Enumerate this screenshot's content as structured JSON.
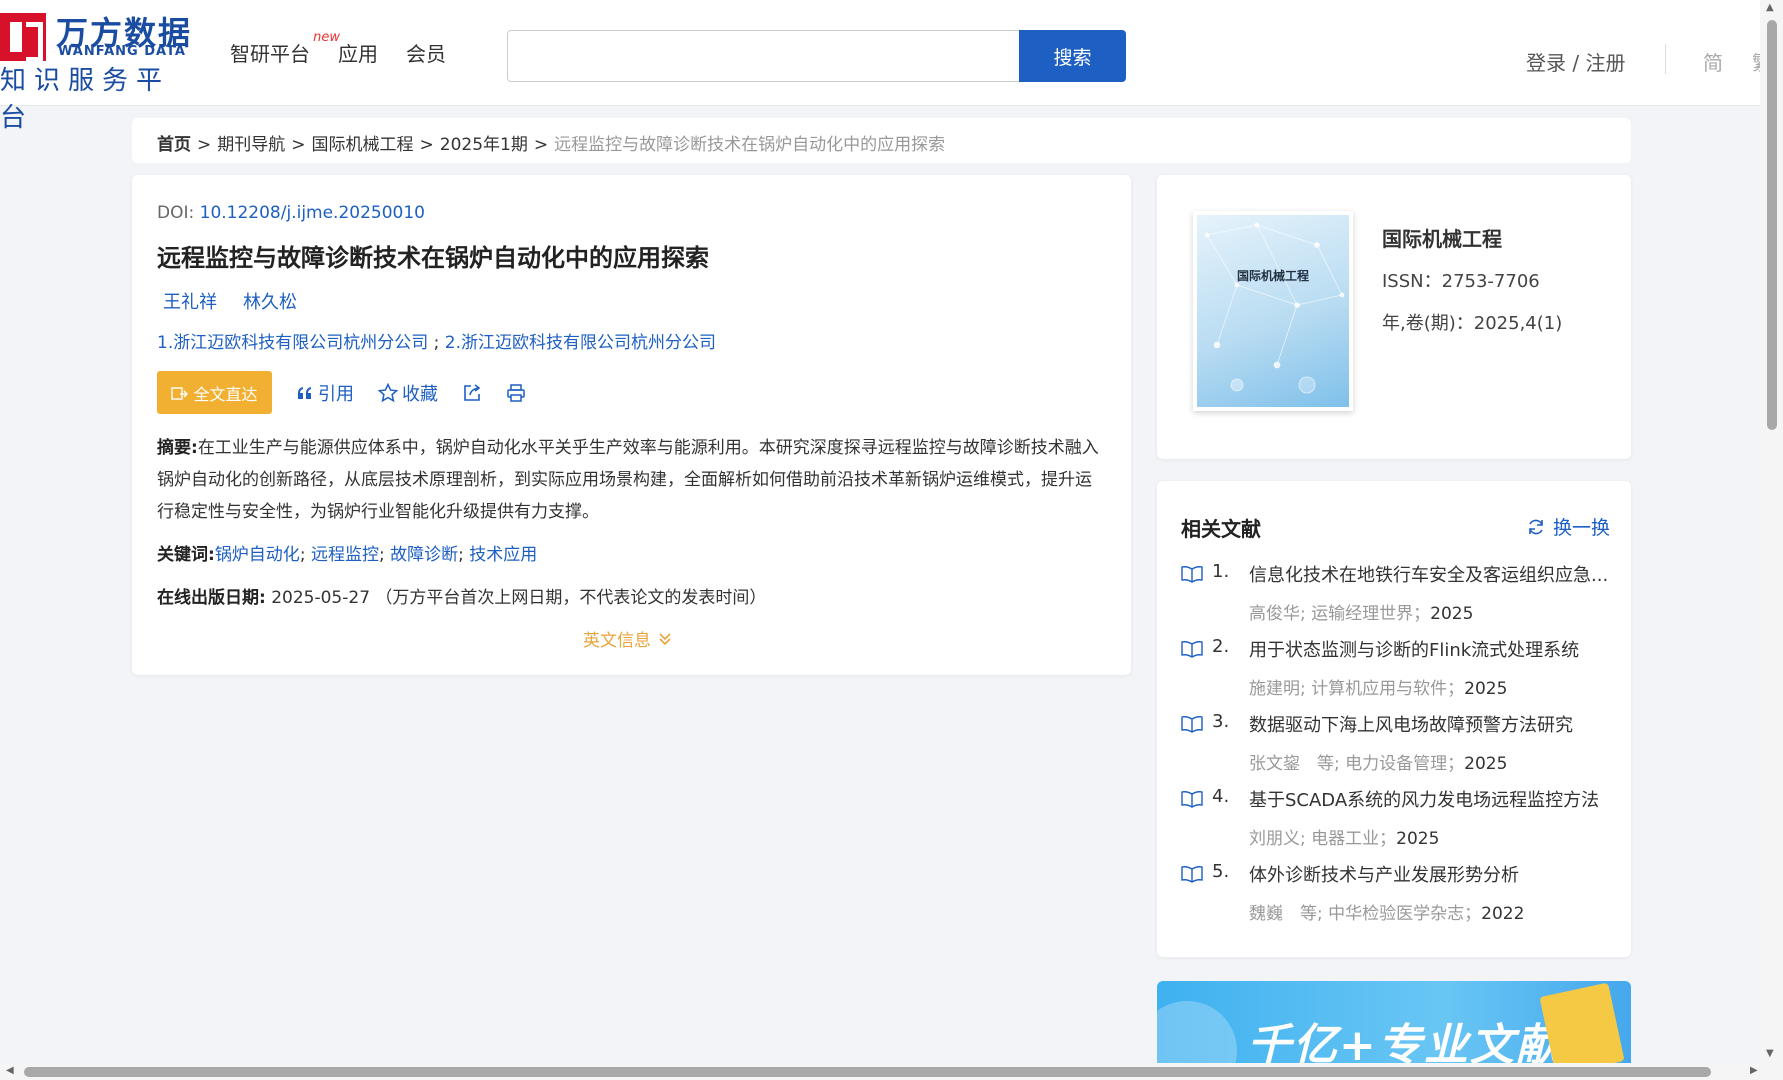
{
  "header": {
    "logo_cn": "万方数据",
    "logo_en": "WANFANG DATA",
    "logo_sub": "知识服务平台",
    "nav": [
      {
        "label": "智研平台",
        "badge": "new"
      },
      {
        "label": "应用"
      },
      {
        "label": "会员"
      }
    ],
    "search": {
      "value": "",
      "button": "搜索"
    },
    "login": "登录 / 注册",
    "lang_simplified": "简",
    "lang_traditional": "繁"
  },
  "breadcrumb": {
    "items": [
      "首页",
      "期刊导航",
      "国际机械工程",
      "2025年1期"
    ],
    "current": "远程监控与故障诊断技术在锅炉自动化中的应用探索"
  },
  "article": {
    "doi_label": "DOI: ",
    "doi": "10.12208/j.ijme.20250010",
    "title": "远程监控与故障诊断技术在锅炉自动化中的应用探索",
    "authors": [
      "王礼祥",
      "林久松"
    ],
    "affiliation_1": "1.浙江迈欧科技有限公司杭州分公司",
    "affiliation_sep": ";",
    "affiliation_2": "2.浙江迈欧科技有限公司杭州分公司",
    "fulltext_button": "全文直达",
    "cite": "引用",
    "favorite": "收藏",
    "abstract_label": "摘要:",
    "abstract": "在工业生产与能源供应体系中，锅炉自动化水平关乎生产效率与能源利用。本研究深度探寻远程监控与故障诊断技术融入锅炉自动化的创新路径，从底层技术原理剖析，到实际应用场景构建，全面解析如何借助前沿技术革新锅炉运维模式，提升运行稳定性与安全性，为锅炉行业智能化升级提供有力支撑。",
    "keywords_label": "关键词:",
    "keywords": [
      "锅炉自动化",
      "远程监控",
      "故障诊断",
      "技术应用"
    ],
    "pubdate_label": "在线出版日期:",
    "pubdate": "2025-05-27",
    "pubdate_note": "（万方平台首次上网日期，不代表论文的发表时间）",
    "english_info": "英文信息"
  },
  "journal": {
    "cover_title": "国际机械工程",
    "name": "国际机械工程",
    "issn": "ISSN：2753-7706",
    "volume": "年,卷(期)：2025,4(1)"
  },
  "related": {
    "title": "相关文献",
    "refresh": "换一换",
    "items": [
      {
        "num": "1.",
        "title": "信息化技术在地铁行车安全及客运组织应急...",
        "meta": "高俊华; 运输经理世界；",
        "year": "2025"
      },
      {
        "num": "2.",
        "title": "用于状态监测与诊断的Flink流式处理系统",
        "meta": "施建明; 计算机应用与软件；",
        "year": "2025"
      },
      {
        "num": "3.",
        "title": "数据驱动下海上风电场故障预警方法研究",
        "meta": "张文鋆　等; 电力设备管理；",
        "year": "2025"
      },
      {
        "num": "4.",
        "title": "基于SCADA系统的风力发电场远程监控方法",
        "meta": "刘朋义; 电器工业；",
        "year": "2025"
      },
      {
        "num": "5.",
        "title": "体外诊断技术与产业发展形势分析",
        "meta": "魏巍　等; 中华检验医学杂志；",
        "year": "2022"
      }
    ]
  },
  "banner": {
    "text": "千亿+专业文献"
  },
  "colors": {
    "accent": "#1d5fc3",
    "brand_red": "#d8112a",
    "fulltext": "#f1b032"
  }
}
